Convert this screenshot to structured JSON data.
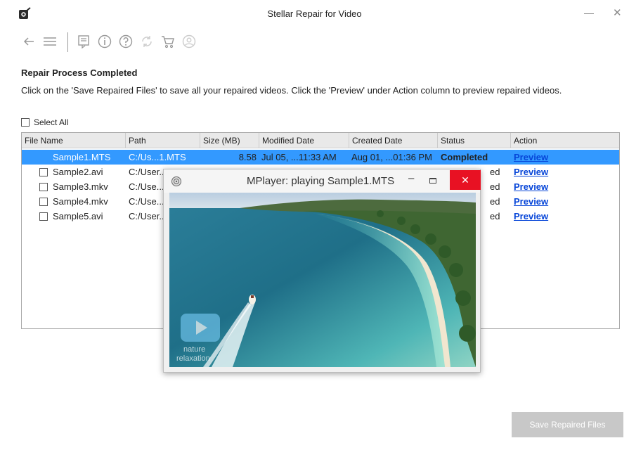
{
  "window": {
    "title": "Stellar Repair for Video",
    "minimize": "—",
    "close": "✕"
  },
  "toolbar": {
    "icons": [
      "back-arrow-icon",
      "menu-icon",
      "register-icon",
      "info-icon",
      "help-icon",
      "refresh-icon",
      "cart-icon",
      "account-icon"
    ]
  },
  "content": {
    "heading": "Repair Process Completed",
    "description": "Click on the 'Save Repaired Files' to save all your repaired videos. Click the 'Preview' under Action column to preview repaired videos.",
    "select_all": "Select All"
  },
  "table": {
    "headers": [
      "File Name",
      "Path",
      "Size (MB)",
      "Modified Date",
      "Created Date",
      "Status",
      "Action"
    ],
    "rows": [
      {
        "name": "Sample1.MTS",
        "path": "C:/Us...1.MTS",
        "size": "8.58",
        "modified": "Jul 05, ...11:33 AM",
        "created": "Aug 01, ...01:36 PM",
        "status": "Completed",
        "action": "Preview"
      },
      {
        "name": "Sample2.avi",
        "path": "C:/User...",
        "size": "",
        "modified": "",
        "created": "",
        "status": "ed",
        "action": "Preview"
      },
      {
        "name": "Sample3.mkv",
        "path": "C:/Use...",
        "size": "",
        "modified": "",
        "created": "",
        "status": "ed",
        "action": "Preview"
      },
      {
        "name": "Sample4.mkv",
        "path": "C:/Use...",
        "size": "",
        "modified": "",
        "created": "",
        "status": "ed",
        "action": "Preview"
      },
      {
        "name": "Sample5.avi",
        "path": "C:/User...",
        "size": "",
        "modified": "",
        "created": "",
        "status": "ed",
        "action": "Preview"
      }
    ]
  },
  "mplayer": {
    "title": "MPlayer: playing Sample1.MTS",
    "minimize": "–",
    "close": "✕",
    "watermark": "nature relaxation"
  },
  "footer": {
    "save_button": "Save Repaired Files"
  },
  "colors": {
    "selection": "#3399ff",
    "link": "#0645d8",
    "close_red": "#e81123",
    "disabled_button": "#c8c8c8"
  }
}
